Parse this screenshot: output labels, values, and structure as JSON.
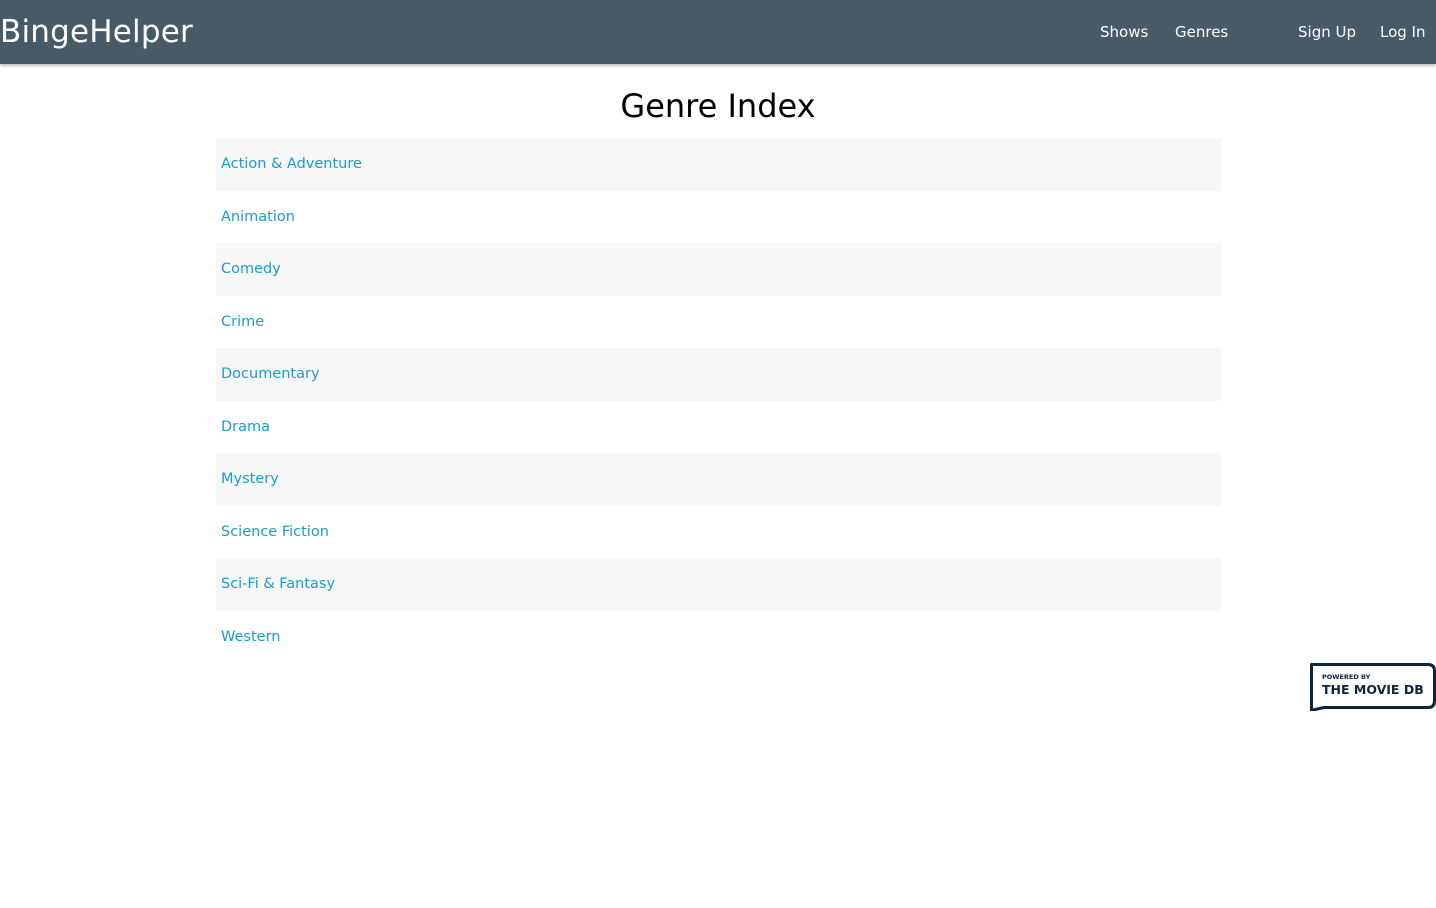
{
  "navbar": {
    "brand": "BingeHelper",
    "links": [
      {
        "label": "Shows"
      },
      {
        "label": "Genres"
      },
      {
        "label": "Sign Up"
      },
      {
        "label": "Log In"
      }
    ]
  },
  "main": {
    "title": "Genre Index",
    "genres": [
      "Action & Adventure",
      "Animation",
      "Comedy",
      "Crime",
      "Documentary",
      "Drama",
      "Mystery",
      "Science Fiction",
      "Sci-Fi & Fantasy",
      "Western"
    ]
  },
  "attribution": {
    "line1": "POWERED BY",
    "line2": "THE MOVIE DB"
  },
  "colors": {
    "navbar": "#475a66",
    "link": "#1a9ccc",
    "stripe": "#f7f7f7"
  }
}
